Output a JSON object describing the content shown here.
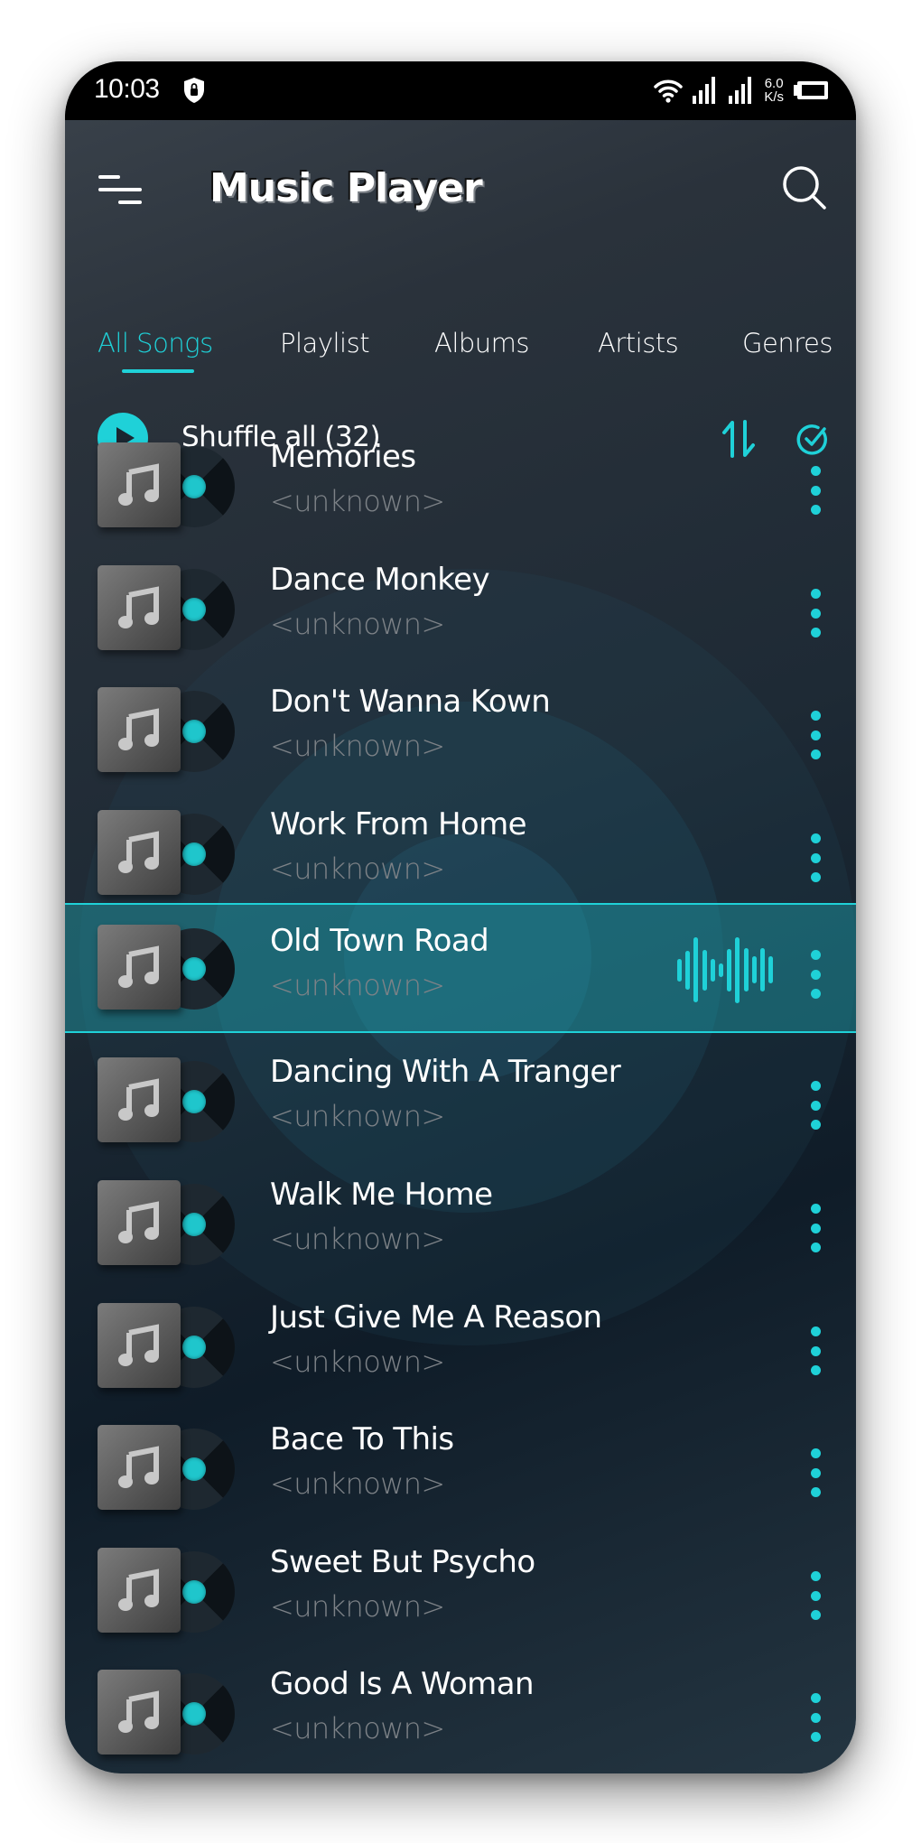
{
  "status_bar": {
    "time": "10:03",
    "network_speed_value": "6.0",
    "network_speed_unit": "K/s",
    "icons": [
      "vpn-shield-icon",
      "wifi-icon",
      "signal-icon",
      "signal-icon",
      "battery-icon"
    ]
  },
  "app_bar": {
    "title": "Music Player",
    "menu_icon": "hamburger-menu-icon",
    "search_icon": "search-icon"
  },
  "tabs": [
    {
      "label": "All Songs",
      "active": true
    },
    {
      "label": "Playlist",
      "active": false
    },
    {
      "label": "Albums",
      "active": false
    },
    {
      "label": "Artists",
      "active": false
    },
    {
      "label": "Genres",
      "active": false
    }
  ],
  "shuffle": {
    "label": "Shuffle all (32)",
    "play_icon": "play-icon",
    "sort_icon": "sort-icon",
    "select_icon": "check-circle-icon"
  },
  "songs": [
    {
      "title": "Memories",
      "artist": "<unknown>",
      "playing": false
    },
    {
      "title": "Dance Monkey",
      "artist": "<unknown>",
      "playing": false
    },
    {
      "title": "Don't Wanna Kown",
      "artist": "<unknown>",
      "playing": false
    },
    {
      "title": "Work From Home",
      "artist": "<unknown>",
      "playing": false
    },
    {
      "title": "Old Town Road",
      "artist": "<unknown>",
      "playing": true
    },
    {
      "title": "Dancing With A Tranger",
      "artist": "<unknown>",
      "playing": false
    },
    {
      "title": "Walk Me Home",
      "artist": "<unknown>",
      "playing": false
    },
    {
      "title": "Just Give Me A Reason",
      "artist": "<unknown>",
      "playing": false
    },
    {
      "title": "Bace To This",
      "artist": "<unknown>",
      "playing": false
    },
    {
      "title": "Sweet But Psycho",
      "artist": "<unknown>",
      "playing": false
    },
    {
      "title": "Good Is A Woman",
      "artist": "<unknown>",
      "playing": false
    }
  ],
  "colors": {
    "accent": "#1fd1d8",
    "background_dark": "#1e2a35",
    "selected_row": "#156d76",
    "artist_text": "#7d8287"
  }
}
